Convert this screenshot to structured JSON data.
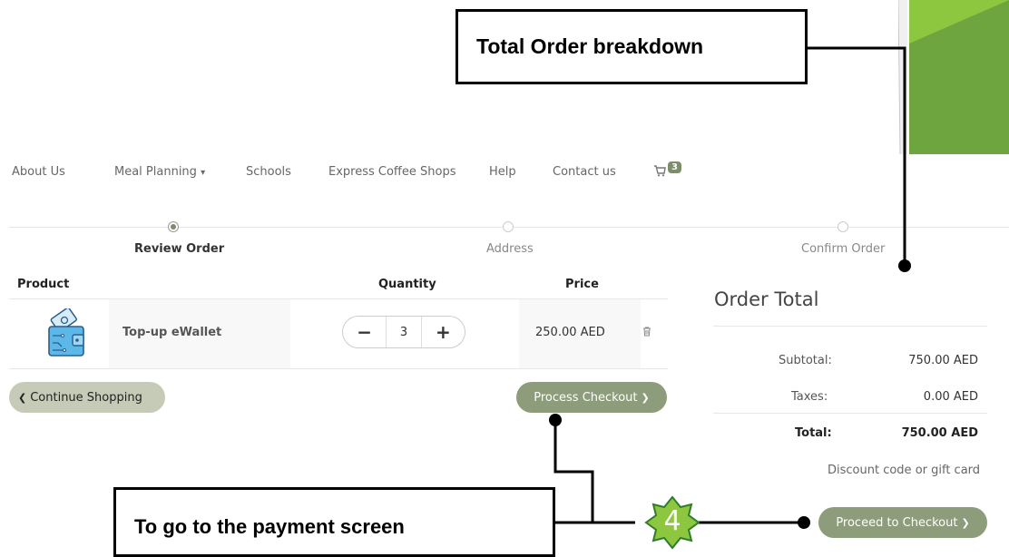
{
  "callouts": {
    "top": "Total Order breakdown",
    "bottom": "To go to the payment screen",
    "step_number": "4"
  },
  "nav": {
    "items": [
      "About Us",
      "Meal Planning",
      "Schools",
      "Express Coffee Shops",
      "Help",
      "Contact us"
    ],
    "meal_planning_caret": "▾",
    "cart_icon": "cart-icon",
    "cart_count": "3"
  },
  "steps": [
    "Review Order",
    "Address",
    "Confirm Order"
  ],
  "table": {
    "headers": [
      "Product",
      "Quantity",
      "Price"
    ],
    "rows": [
      {
        "name": "Top-up eWallet",
        "icon": "wallet-icon",
        "quantity": "3",
        "price": "250.00 AED"
      }
    ]
  },
  "buttons": {
    "continue": "Continue Shopping",
    "continue_icon": "❮",
    "process": "Process Checkout",
    "process_icon": "❯",
    "minus": "−",
    "plus": "+",
    "trash_icon": "🗑"
  },
  "order_total": {
    "title": "Order Total",
    "subtotal_label": "Subtotal:",
    "subtotal_value": "750.00 AED",
    "taxes_label": "Taxes:",
    "taxes_value": "0.00 AED",
    "total_label": "Total:",
    "total_value": "750.00 AED",
    "discount": "Discount code or gift card",
    "proceed": "Proceed to Checkout",
    "proceed_icon": "❯"
  },
  "colors": {
    "accent": "#8d9c7a",
    "accent_light": "#c5cbb7",
    "callout_star": "#8dc63f",
    "slide_green": "#70a841"
  }
}
